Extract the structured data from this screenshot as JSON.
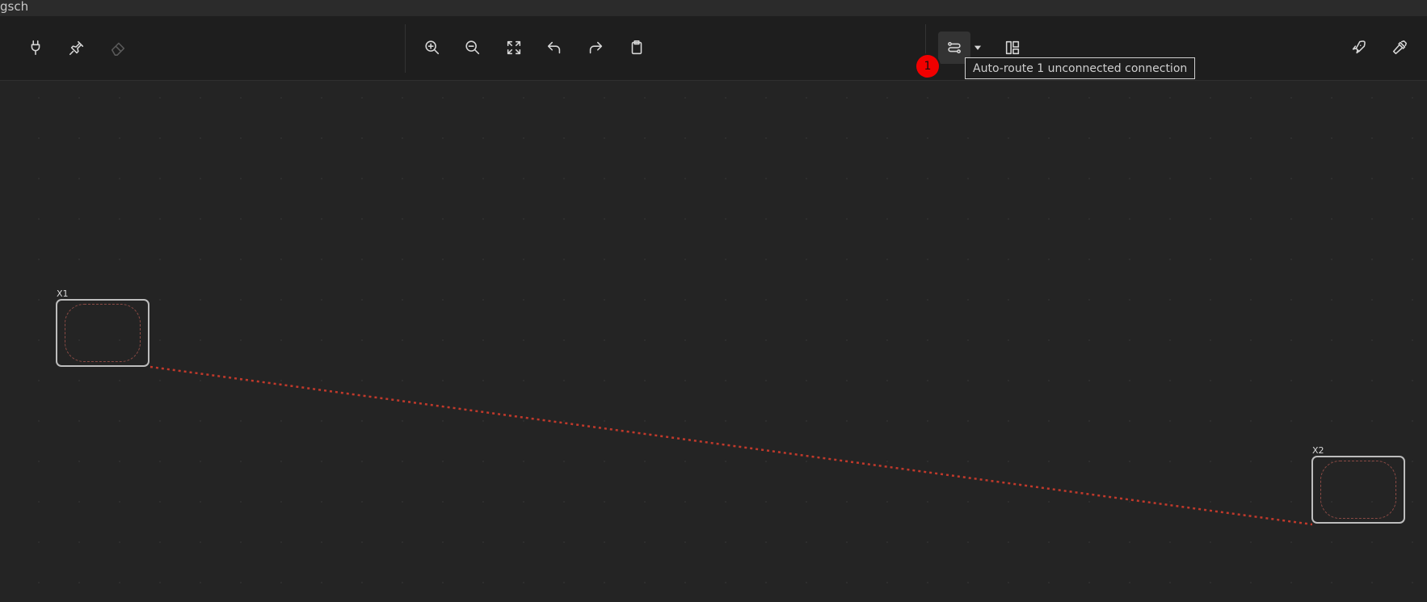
{
  "window": {
    "title_fragment": "gsch"
  },
  "toolbar": {
    "left_group": [
      {
        "name": "plug-icon",
        "disabled": false
      },
      {
        "name": "pin-icon",
        "disabled": false
      },
      {
        "name": "eraser-icon",
        "disabled": true
      }
    ],
    "view_group": [
      {
        "name": "zoom-in-icon"
      },
      {
        "name": "zoom-out-icon"
      },
      {
        "name": "fit-view-icon"
      },
      {
        "name": "undo-icon"
      },
      {
        "name": "redo-icon"
      },
      {
        "name": "clipboard-icon"
      }
    ],
    "route_group": [
      {
        "name": "auto-route-icon",
        "active": true
      },
      {
        "name": "dropdown-caret-icon"
      },
      {
        "name": "layout-icon"
      }
    ],
    "right_group": [
      {
        "name": "rocket-icon"
      },
      {
        "name": "hammer-icon"
      }
    ],
    "badge_count": "1",
    "tooltip": "Auto-route 1 unconnected connection"
  },
  "canvas": {
    "components": [
      {
        "id": "X1",
        "label": "X1"
      },
      {
        "id": "X2",
        "label": "X2"
      }
    ],
    "connection": {
      "from": "X1",
      "to": "X2",
      "status": "unconnected",
      "color": "#c0392b"
    }
  },
  "colors": {
    "background": "#242424",
    "toolbar": "#1e1e1e",
    "badge": "#f10000",
    "ratsnest": "#c0392b"
  }
}
